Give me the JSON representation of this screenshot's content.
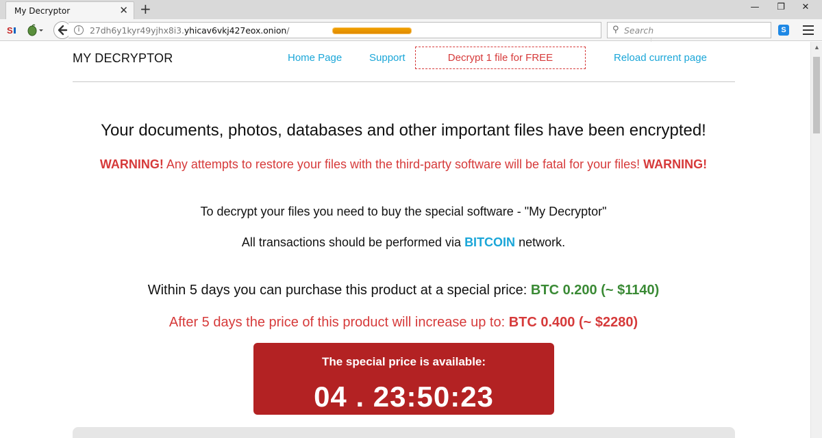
{
  "browser": {
    "tab_title": "My Decryptor",
    "tab_close": "✕",
    "new_tab": "+",
    "url_prefix": "27dh6y1kyr49yjhx8i3.",
    "url_host": "yhicav6vkj427eox.onion",
    "url_slash": "/",
    "search_placeholder": "Search",
    "win_minimize": "—",
    "win_restore": "❐",
    "win_close": "✕",
    "icons": [
      "s-extension-icon",
      "tor-onion-icon",
      "back-arrow-icon",
      "info-icon",
      "reload-icon",
      "search-icon",
      "skype-icon",
      "hamburger-menu-icon"
    ]
  },
  "header": {
    "brand": "MY DECRYPTOR",
    "nav": {
      "home": "Home Page",
      "support": "Support",
      "decrypt_free": "Decrypt 1 file for FREE",
      "reload": "Reload current page"
    }
  },
  "main": {
    "headline": "Your documents, photos, databases and other important files have been encrypted!",
    "warning_word": "WARNING!",
    "warning_text": " Any attempts to restore your files with the third-party software will be fatal for your files! ",
    "p1": "To decrypt your files you need to buy the special software - \"My Decryptor\"",
    "p2_before": "All transactions should be performed via ",
    "p2_bitcoin": "BITCOIN",
    "p2_after": " network.",
    "p3_text": "Within 5 days you can purchase this product at a special price: ",
    "p3_price": "BTC 0.200 (~ $1140)",
    "p4_text": "After 5 days the price of this product will increase up to: ",
    "p4_price": "BTC 0.400 (~ $2280)",
    "timer_label": "The special price is available:",
    "timer_value": "04 . 23:50:23"
  },
  "colors": {
    "accent_blue": "#1aa6d8",
    "warning_red": "#d63a3a",
    "price_green": "#3a8a35",
    "timer_bg": "#b32223"
  }
}
